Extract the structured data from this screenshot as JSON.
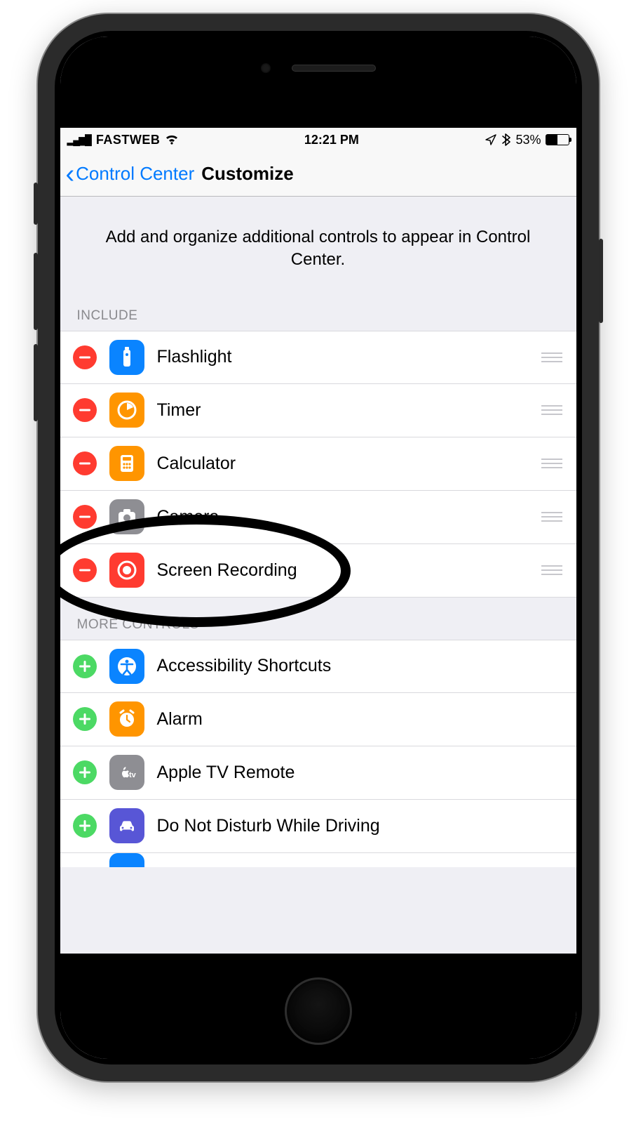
{
  "status": {
    "carrier": "FASTWEB",
    "time": "12:21 PM",
    "battery_pct": "53%"
  },
  "nav": {
    "back_label": "Control Center",
    "title": "Customize"
  },
  "intro": "Add and organize additional controls to appear in Control Center.",
  "sections": {
    "include_header": "INCLUDE",
    "more_header": "MORE CONTROLS"
  },
  "include": [
    {
      "label": "Flashlight",
      "icon": "flashlight",
      "color": "blue"
    },
    {
      "label": "Timer",
      "icon": "timer",
      "color": "orange"
    },
    {
      "label": "Calculator",
      "icon": "calculator",
      "color": "orange"
    },
    {
      "label": "Camera",
      "icon": "camera",
      "color": "gray"
    },
    {
      "label": "Screen Recording",
      "icon": "record",
      "color": "red",
      "highlighted": true
    }
  ],
  "more": [
    {
      "label": "Accessibility Shortcuts",
      "icon": "accessibility",
      "color": "blue"
    },
    {
      "label": "Alarm",
      "icon": "alarm",
      "color": "orange"
    },
    {
      "label": "Apple TV Remote",
      "icon": "appletv",
      "color": "gray"
    },
    {
      "label": "Do Not Disturb While Driving",
      "icon": "car",
      "color": "purple"
    }
  ]
}
